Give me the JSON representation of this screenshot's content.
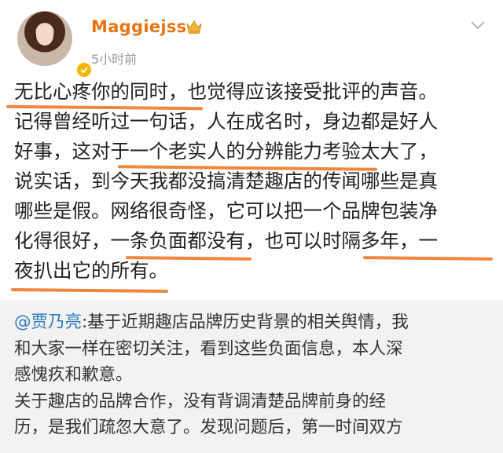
{
  "post": {
    "username": "Maggiejss",
    "timestamp": "5小时前",
    "icons": {
      "avatar": "user-avatar",
      "verified": "verified-badge-icon",
      "crown": "crown-icon",
      "dropdown": "chevron-down-icon"
    },
    "body_lines": [
      "无比心疼你的同时，也觉得应该接受批评的声音。",
      "记得曾经听过一句话，人在成名时，身边都是好人",
      "好事，这对于一个老实人的分辨能力考验太大了，",
      "说实话，到今天我都没搞清楚趣店的传闻哪些是真",
      "哪些是假。网络很奇怪，它可以把一个品牌包装净",
      "化得很好，一条负面都没有，也可以时隔多年，一",
      "夜扒出它的所有。"
    ],
    "colors": {
      "username": "#e8730f",
      "underline": "#ee7a28",
      "mention": "#2e7bbf",
      "repost_bg": "#f2f2f2"
    }
  },
  "repost": {
    "mention": "@贾乃亮",
    "first_line_rest": ":基于近期趣店品牌历史背景的相关舆情，我",
    "lines": [
      "和大家一样在密切关注，看到这些负面信息，本人深",
      "感愧疚和歉意。",
      "关于趣店的品牌合作，没有背调清楚品牌前身的经",
      "历，是我们疏忽大意了。发现问题后，第一时间双方"
    ]
  }
}
